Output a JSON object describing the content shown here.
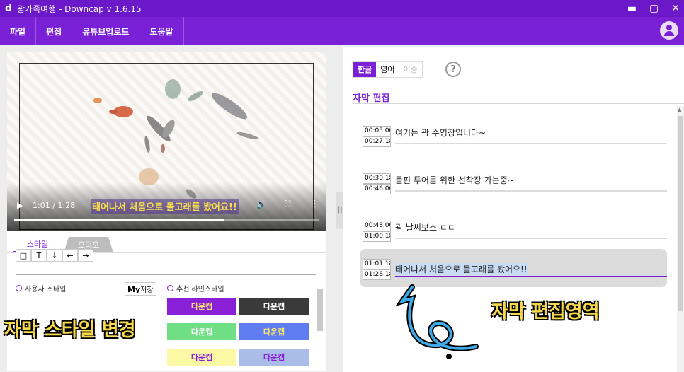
{
  "window": {
    "logo": "d",
    "title": "광가족여행 - Downcap v 1.6.15",
    "buttons": [
      "minimize-icon",
      "maximize-icon",
      "close-icon"
    ]
  },
  "menu": [
    "파일",
    "편집",
    "유튜브업로드",
    "도움말"
  ],
  "video": {
    "time": "1:01 / 1:28",
    "subtitle": "태어나서 처음으로 돌고래를 봤어요!!",
    "progress": 0.69
  },
  "style_tabs": [
    "스타일",
    "오디오"
  ],
  "style_panel": {
    "toolbar": [
      "□",
      "T",
      "↓",
      "←",
      "→"
    ],
    "user_style_label": "사용자 스타일",
    "my_save": {
      "my": "My",
      "label": "저장"
    },
    "recommended_label": "추천 라인스타일",
    "style_buttons": [
      {
        "label": "다운캡",
        "bg": "#8a1fd8",
        "fg": "#f6e86a"
      },
      {
        "label": "다운캡",
        "bg": "#3a3a3a",
        "fg": "#ffffff"
      },
      {
        "label": "다운캡",
        "bg": "#6fde84",
        "fg": "#ffffff"
      },
      {
        "label": "다운캡",
        "bg": "#5f7df0",
        "fg": "#f6e86a"
      },
      {
        "label": "다운캡",
        "bg": "#fbf9a6",
        "fg": "#8a1fd8"
      },
      {
        "label": "다운캡",
        "bg": "#a9bde8",
        "fg": "#8a1fd8"
      }
    ]
  },
  "annotations": {
    "left": "자막 스타일 변경",
    "right": "자막 편집영역"
  },
  "lang_tabs": [
    "한글",
    "영어",
    "이중"
  ],
  "help": "?",
  "section_title": "자막 편집",
  "subtitles": [
    {
      "start": "00:05.00",
      "end": "00:27.18",
      "text": "여기는 괌 수영장입니다~"
    },
    {
      "start": "00:30.18",
      "end": "00:46.00",
      "text": "돌핀 투어를 위한 선착장 가는중~"
    },
    {
      "start": "00:48.00",
      "end": "01:00.18",
      "text": "괌 날씨보소 ㄷㄷ"
    },
    {
      "start": "01:01.18",
      "end": "01:28.18",
      "text": "태어나서 처음으로 돌고래를 봤어요!!"
    }
  ],
  "colors": {
    "brand": "#7a21d8",
    "annotation": "#f6d84a"
  }
}
